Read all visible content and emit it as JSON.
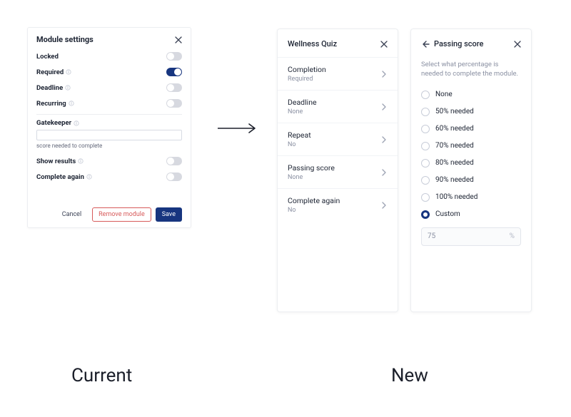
{
  "labels": {
    "current": "Current",
    "new": "New"
  },
  "current_panel": {
    "title": "Module settings",
    "rows": {
      "locked": {
        "label": "Locked",
        "on": false,
        "info": false
      },
      "required": {
        "label": "Required",
        "on": true,
        "info": true
      },
      "deadline": {
        "label": "Deadline",
        "on": false,
        "info": true
      },
      "recurring": {
        "label": "Recurring",
        "on": false,
        "info": true
      }
    },
    "gatekeeper": {
      "label": "Gatekeeper",
      "helper": "score needed to complete",
      "value": ""
    },
    "rows2": {
      "show_results": {
        "label": "Show results",
        "on": false,
        "info": true
      },
      "complete_again": {
        "label": "Complete again",
        "on": false,
        "info": true
      }
    },
    "buttons": {
      "cancel": "Cancel",
      "remove": "Remove module",
      "save": "Save"
    }
  },
  "new_panel_list": {
    "title": "Wellness Quiz",
    "items": [
      {
        "name": "Completion",
        "value": "Required"
      },
      {
        "name": "Deadline",
        "value": "None"
      },
      {
        "name": "Repeat",
        "value": "No"
      },
      {
        "name": "Passing score",
        "value": "None"
      },
      {
        "name": "Complete again",
        "value": "No"
      }
    ]
  },
  "new_panel_detail": {
    "title": "Passing score",
    "description": "Select what percentage is needed to complete the module.",
    "options": [
      {
        "label": "None"
      },
      {
        "label": "50% needed"
      },
      {
        "label": "60% needed"
      },
      {
        "label": "70% needed"
      },
      {
        "label": "80% needed"
      },
      {
        "label": "90% needed"
      },
      {
        "label": "100% needed"
      },
      {
        "label": "Custom"
      }
    ],
    "selected_index": 7,
    "custom_value": "75",
    "custom_unit": "%"
  }
}
